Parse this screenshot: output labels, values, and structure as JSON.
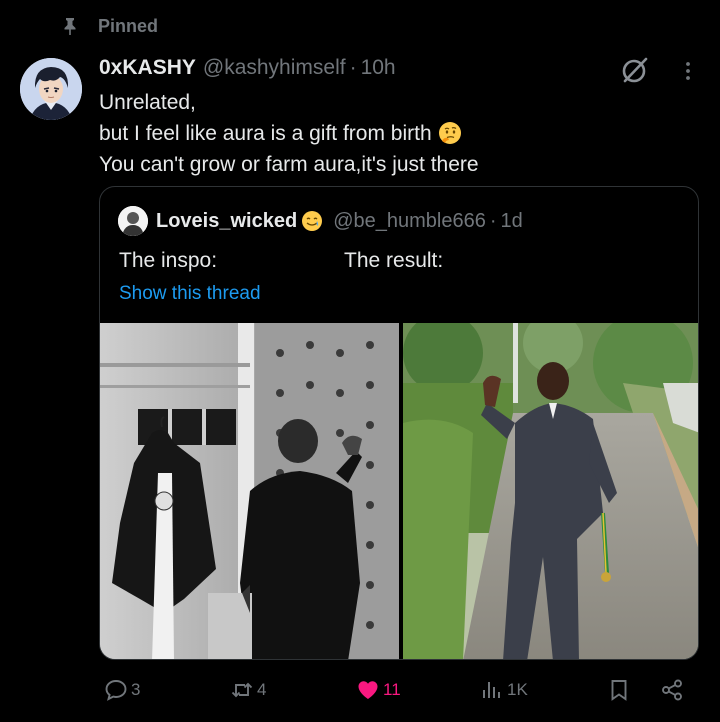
{
  "pinned": {
    "label": "Pinned"
  },
  "tweet": {
    "author_name": "0xKASHY",
    "author_handle": "@kashyhimself",
    "dot": "·",
    "time": "10h",
    "lines": [
      "Unrelated,",
      "but I feel like aura is a gift from birth",
      "You can't grow or farm aura,it's just there"
    ],
    "emoji_icon": "thinking-face-emoji"
  },
  "quote": {
    "author_name": "Loveis_wicked",
    "emoji_icon": "crying-smile-emoji",
    "author_handle": "@be_humble666",
    "dot": "·",
    "time": "1d",
    "text_left": "The inspo:",
    "text_right": "The result:",
    "show_thread": "Show this thread"
  },
  "actions": {
    "replies": "3",
    "reposts": "4",
    "likes": "11",
    "views": "1K"
  },
  "colors": {
    "background": "#000000",
    "text": "#e7e9ea",
    "muted": "#71767b",
    "link": "#1d9bf0",
    "like": "#f91880",
    "border": "#2f3336"
  }
}
